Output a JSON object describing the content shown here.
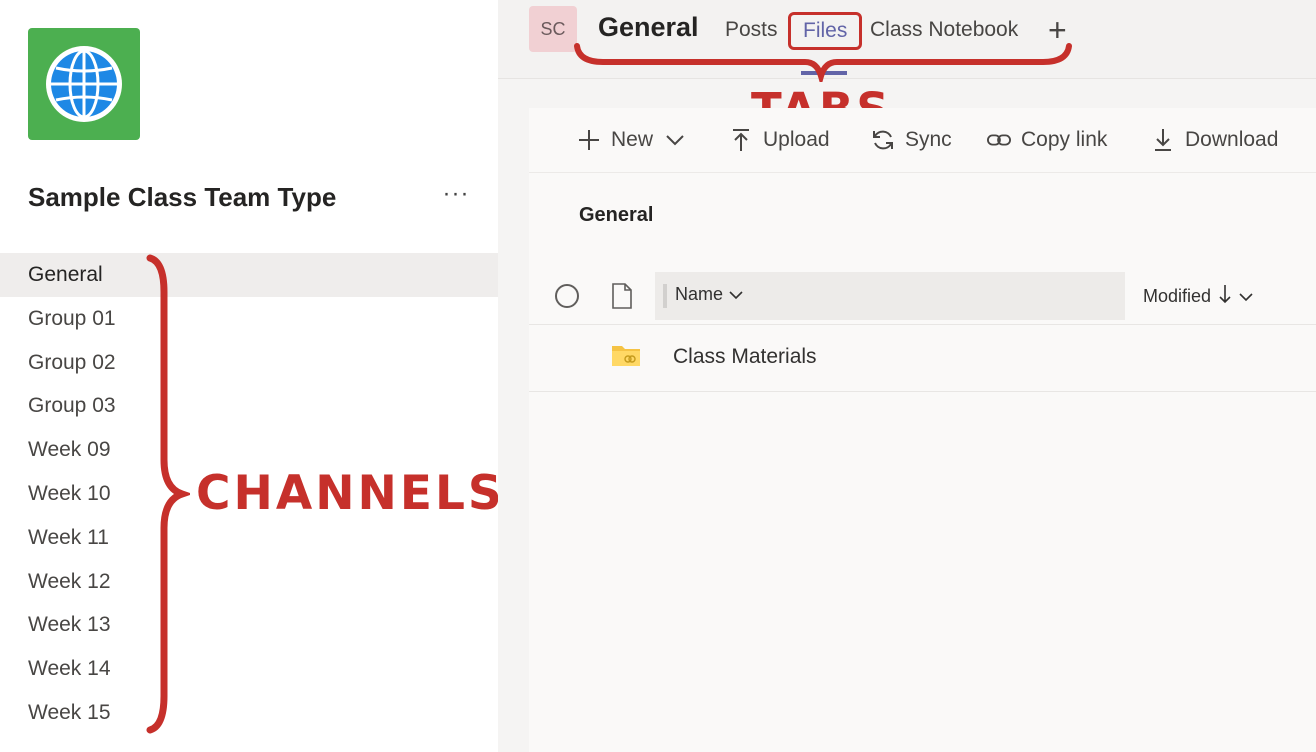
{
  "team": {
    "name": "Sample Class Team Type",
    "more_label": "···",
    "logo_icon": "globe-icon",
    "logo_color": "#4caf50"
  },
  "channels": [
    {
      "label": "General",
      "active": true
    },
    {
      "label": "Group 01"
    },
    {
      "label": "Group 02"
    },
    {
      "label": "Group 03"
    },
    {
      "label": "Week 09"
    },
    {
      "label": "Week 10"
    },
    {
      "label": "Week 11"
    },
    {
      "label": "Week 12"
    },
    {
      "label": "Week 13"
    },
    {
      "label": "Week 14"
    },
    {
      "label": "Week 15"
    }
  ],
  "annotations": {
    "channels_label": "CHANNELS",
    "tabs_label": "TABS",
    "color": "#c6302b"
  },
  "header": {
    "avatar_initials": "SC",
    "channel_title": "General",
    "tabs": {
      "posts": "Posts",
      "files": "Files",
      "notebook": "Class Notebook",
      "add": "+"
    },
    "active_tab": "Files",
    "accent_color": "#6264a7"
  },
  "toolbar": {
    "new_label": "New",
    "upload_label": "Upload",
    "sync_label": "Sync",
    "copy_link_label": "Copy link",
    "download_label": "Download"
  },
  "files": {
    "folder_title": "General",
    "columns": {
      "name": "Name",
      "modified": "Modified"
    },
    "sort_column": "Modified",
    "sort_direction": "descending",
    "rows": [
      {
        "name": "Class Materials",
        "type": "shared-folder-icon"
      }
    ]
  }
}
